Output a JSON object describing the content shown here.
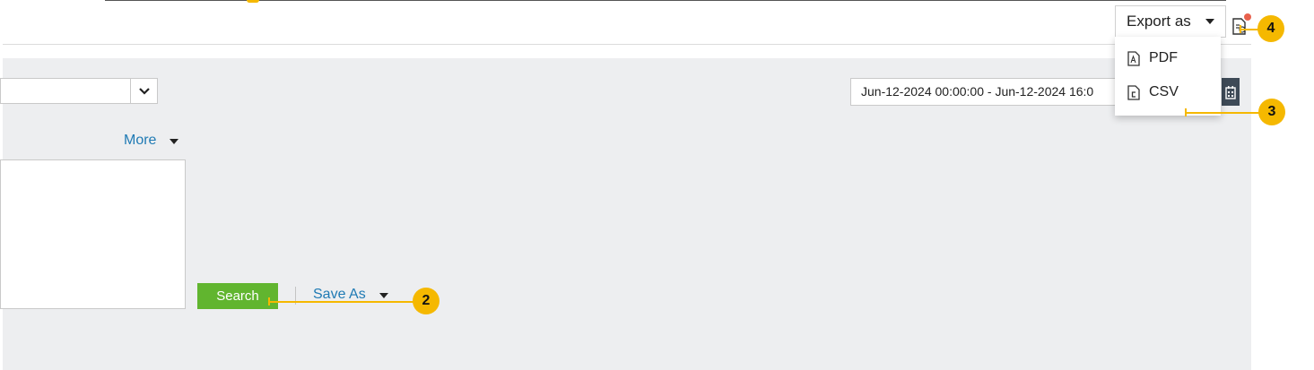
{
  "search_form": {
    "more_label": "More",
    "search_label": "Search",
    "save_as_label": "Save As"
  },
  "date_range": {
    "value": "Jun-12-2024 00:00:00 - Jun-12-2024 16:0"
  },
  "export": {
    "label": "Export as",
    "options": [
      "PDF",
      "CSV"
    ]
  },
  "callouts": [
    "2",
    "3",
    "4"
  ],
  "colors": {
    "search_button": "#61b52f",
    "link": "#1f7ab4",
    "callout": "#f5b800",
    "panel": "#edeef0",
    "notification_dot": "#e8614d"
  }
}
